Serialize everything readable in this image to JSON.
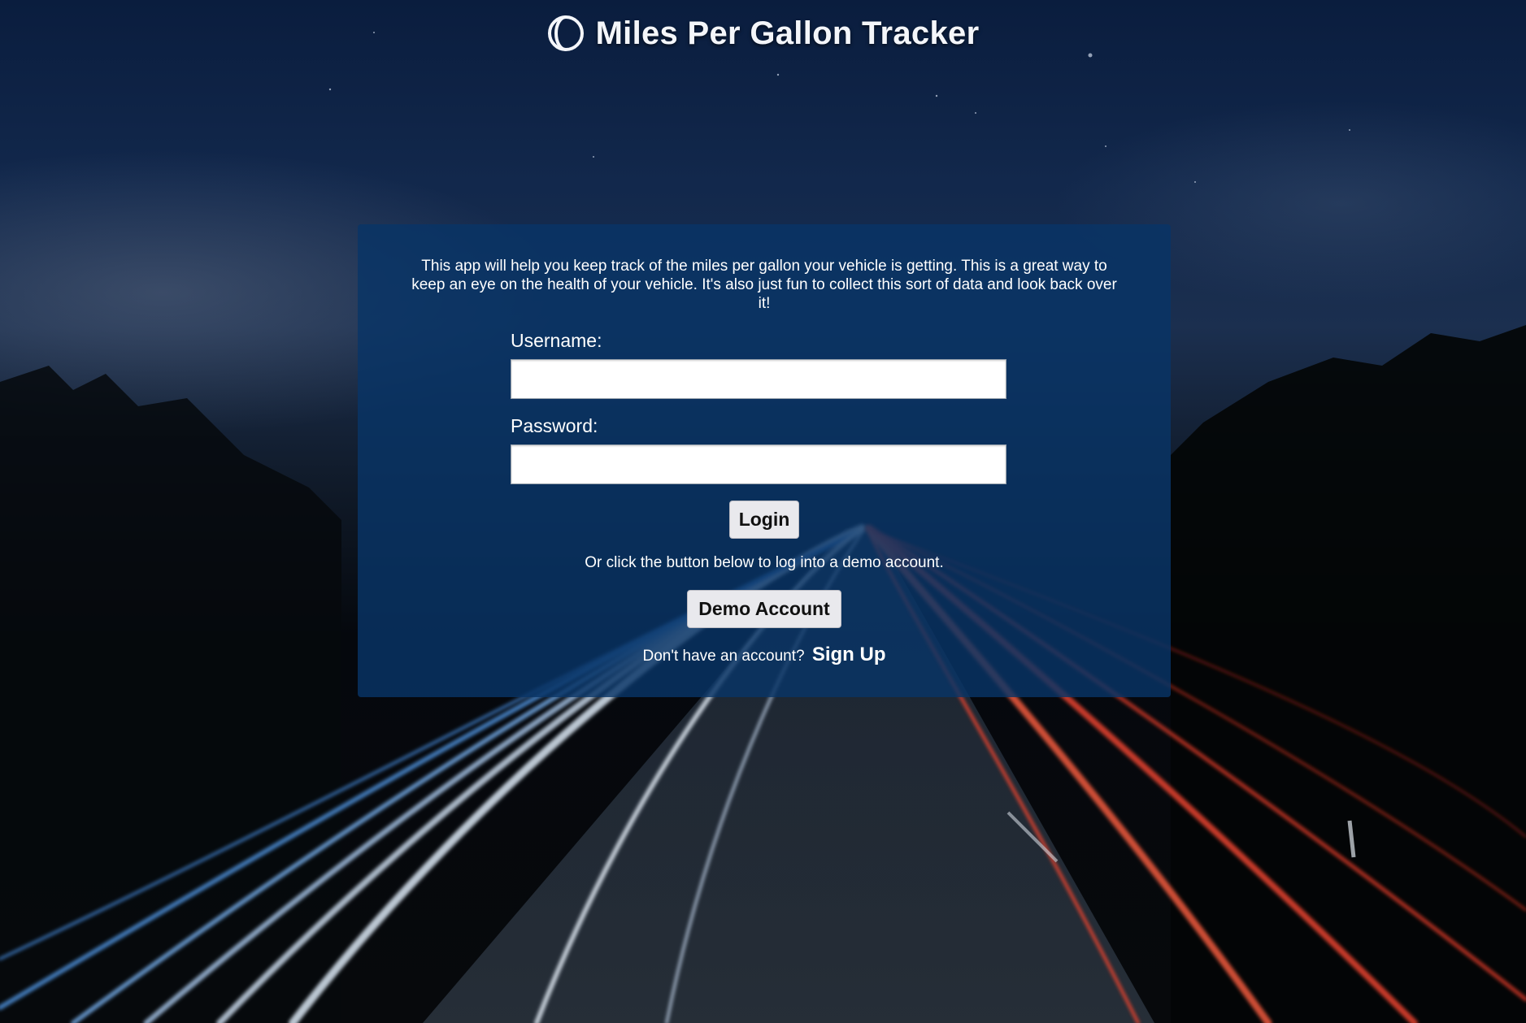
{
  "header": {
    "logo_icon": "half-moon-circle-icon",
    "title": "Miles Per Gallon Tracker"
  },
  "panel": {
    "intro": "This app will help you keep track of the miles per gallon your vehicle is getting. This is a great way to keep an eye on the health of your vehicle. It's also just fun to collect this sort of data and look back over it!",
    "username_label": "Username:",
    "username_value": "",
    "password_label": "Password:",
    "password_value": "",
    "login_label": "Login",
    "demo_text": "Or click the button below to log into a demo account.",
    "demo_label": "Demo Account",
    "signup_prompt": "Don't have an account?",
    "signup_label": "Sign Up"
  },
  "colors": {
    "panel": "#083466",
    "button": "#e9e9ed",
    "trail_white": "#dbe7f5",
    "trail_blue": "#4a8ad0",
    "trail_red": "#e8432e"
  }
}
